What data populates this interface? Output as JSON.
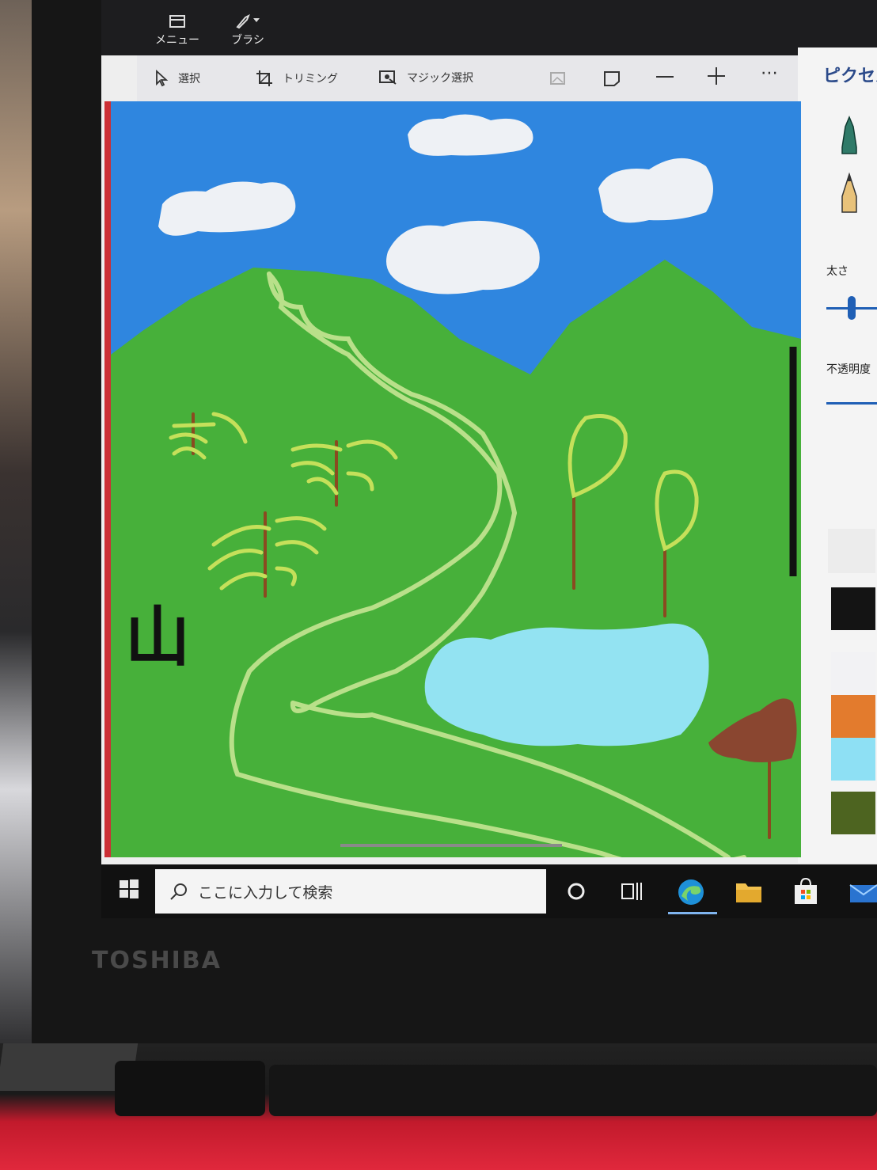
{
  "app": {
    "menu_label": "メニュー",
    "brush_label": "ブラシ"
  },
  "toolbar": {
    "select_label": "選択",
    "crop_label": "トリミング",
    "magic_select_label": "マジック選択",
    "more_label": "⋯"
  },
  "side_panel": {
    "header": "ピクセル",
    "thickness_label": "太さ",
    "thickness_value": 0.5,
    "opacity_label": "不透明度",
    "swatches": [
      "#ffffff",
      "#141414",
      "#f2f2f4",
      "#e37b2d",
      "#8ee0f4",
      "#4d6420"
    ]
  },
  "canvas": {
    "text_mark": "山",
    "sky_color": "#2f86df",
    "grass_color": "#47b03a",
    "path_color": "#b9e08a",
    "pond_color": "#93e3f2",
    "cloud_color": "#eef1f5"
  },
  "taskbar": {
    "search_placeholder": "ここに入力して検索"
  },
  "laptop": {
    "brand": "TOSHIBA"
  }
}
